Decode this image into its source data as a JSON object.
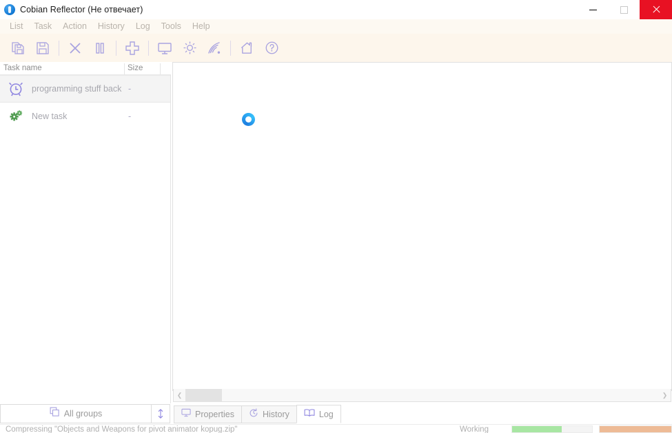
{
  "window": {
    "title": "Cobian Reflector (Не отвечает)",
    "app_icon": "cobian-app-icon",
    "controls": {
      "minimize": "minimize-icon",
      "maximize": "maximize-icon",
      "close": "close-icon",
      "close_color": "#e81123"
    }
  },
  "menu": {
    "items": [
      {
        "label": "List"
      },
      {
        "label": "Task"
      },
      {
        "label": "Action"
      },
      {
        "label": "History"
      },
      {
        "label": "Log"
      },
      {
        "label": "Tools"
      },
      {
        "label": "Help"
      }
    ]
  },
  "toolbar": {
    "accent": "#a9a3e0",
    "background": "#fdf6ec",
    "buttons": [
      {
        "name": "copy-task-icon",
        "tip": "Copy task"
      },
      {
        "name": "save-icon",
        "tip": "Save"
      },
      {
        "sep": true
      },
      {
        "name": "close-task-icon",
        "tip": "Remove task"
      },
      {
        "name": "pause-icon",
        "tip": "Pause"
      },
      {
        "sep": true
      },
      {
        "name": "add-task-icon",
        "tip": "New task"
      },
      {
        "sep": true
      },
      {
        "name": "monitor-icon",
        "tip": "Properties"
      },
      {
        "name": "gear-icon",
        "tip": "Options"
      },
      {
        "name": "signal-icon",
        "tip": "Remote"
      },
      {
        "sep": true
      },
      {
        "name": "home-icon",
        "tip": "Home"
      },
      {
        "name": "help-icon",
        "tip": "Help"
      }
    ]
  },
  "task_list": {
    "columns": [
      {
        "label": "Task name"
      },
      {
        "label": "Size"
      }
    ],
    "rows": [
      {
        "icon": "alarm-clock-icon",
        "icon_color": "#8f86e0",
        "name": "programming stuff back",
        "size": "-",
        "selected": true
      },
      {
        "icon": "gears-icon",
        "icon_color": "#7cb87c",
        "name": "New task",
        "size": "-",
        "selected": false
      }
    ]
  },
  "group_bar": {
    "all_groups_label": "All groups",
    "all_groups_icon": "copy-layers-icon",
    "resize_icon": "vertical-resize-icon"
  },
  "detail_panel": {
    "state_icon": "loading-spinner-icon",
    "scrollbar": {
      "left_arrow": "chevron-left-icon",
      "right_arrow": "chevron-right-icon"
    }
  },
  "tabs": [
    {
      "label": "Properties",
      "icon": "monitor-icon",
      "active": false
    },
    {
      "label": "History",
      "icon": "history-clock-icon",
      "active": false
    },
    {
      "label": "Log",
      "icon": "book-icon",
      "active": true
    }
  ],
  "status_bar": {
    "message": "Compressing \"Objects and Weapons for pivot animator  kopug.zip\"",
    "state": "Working",
    "progress_primary": {
      "percent": 62,
      "color": "#a8e6a3"
    },
    "progress_secondary": {
      "percent": 100,
      "color": "#eebb96"
    }
  }
}
